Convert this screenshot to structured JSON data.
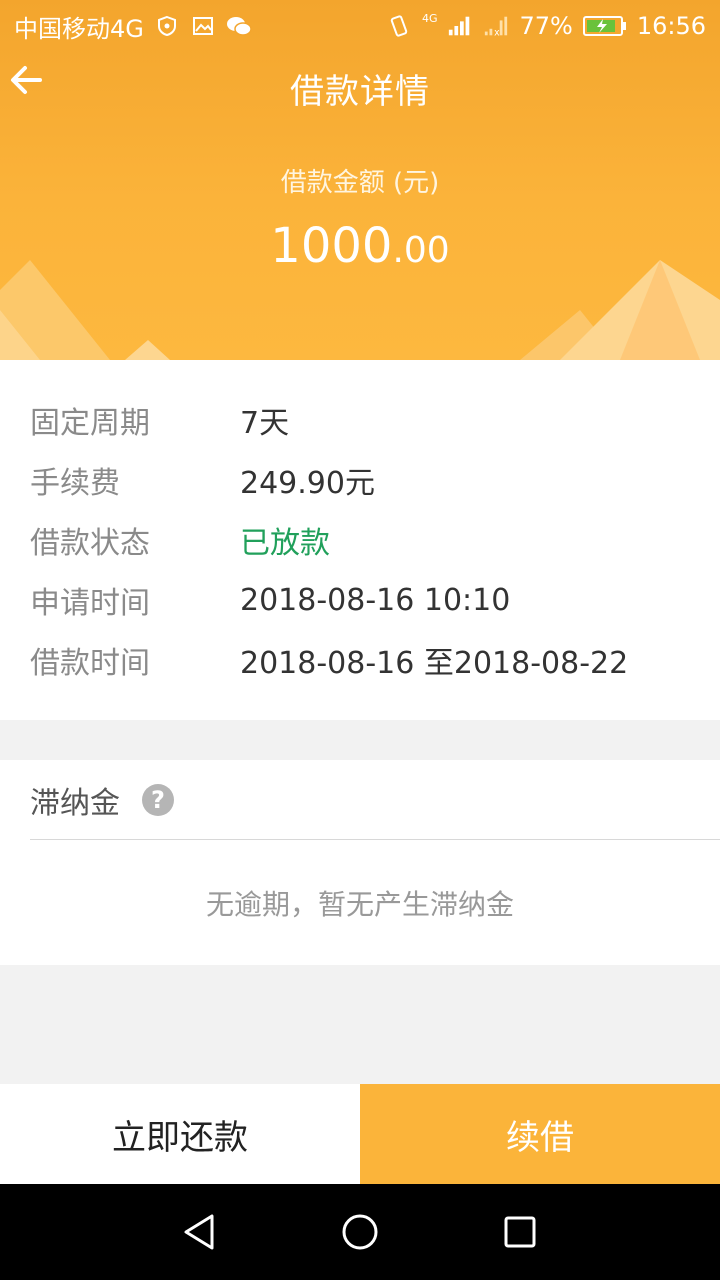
{
  "status_bar": {
    "carrier": "中国移动4G",
    "network_small": "4G",
    "battery": "77%",
    "time": "16:56"
  },
  "header": {
    "title": "借款详情",
    "amount_label": "借款金额 (元)",
    "amount_integer": "1000",
    "amount_decimal": ".00"
  },
  "details": {
    "rows": [
      {
        "label": "固定周期",
        "value": "7天"
      },
      {
        "label": "手续费",
        "value": "249.90元"
      },
      {
        "label": "借款状态",
        "value": "已放款"
      },
      {
        "label": "申请时间",
        "value": "2018-08-16 10:10"
      },
      {
        "label": "借款时间",
        "value": "2018-08-16 至2018-08-22"
      }
    ]
  },
  "late_fee": {
    "title": "滞纳金",
    "help_symbol": "?",
    "message": "无逾期，暂无产生滞纳金"
  },
  "actions": {
    "repay_label": "立即还款",
    "renew_label": "续借"
  },
  "colors": {
    "accent": "#fbb43a",
    "status_green": "#21a05b"
  },
  "icons": {
    "back": "arrow-left-icon",
    "help": "question-circle-icon",
    "nav_back": "triangle-back-icon",
    "nav_home": "circle-home-icon",
    "nav_recent": "square-recent-icon"
  }
}
